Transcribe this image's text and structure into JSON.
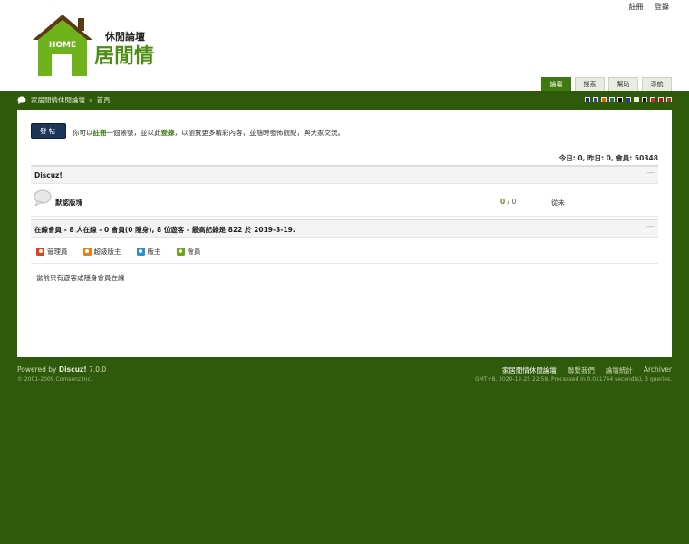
{
  "header": {
    "top_links": [
      "註冊",
      "登錄"
    ],
    "logo": {
      "home_text": "HOME",
      "subtitle": "休閒論壇",
      "title": "居閒情"
    },
    "tabs": [
      {
        "label": "論壇",
        "active": true
      },
      {
        "label": "搜索",
        "active": false
      },
      {
        "label": "幫助",
        "active": false
      },
      {
        "label": "導航",
        "active": false
      }
    ]
  },
  "breadcrumb": {
    "site": "家居閒情休閒論壇",
    "separator": "»",
    "current": "首頁"
  },
  "style_swatches": [
    "#1a2f66",
    "#2a4b8d",
    "#e06010",
    "#2c6a6a",
    "#101010",
    "#1f3f7f",
    "#f0f0c0",
    "#101010",
    "#c03030",
    "#b01818",
    "#a04020"
  ],
  "post_button": "發帖",
  "notice": {
    "prefix": "你可以",
    "register": "註冊",
    "middle": "一個帳號，並以此",
    "login": "登錄",
    "suffix": "，以瀏覽更多精彩內容，並隨時發佈觀點，與大家交流。"
  },
  "stats": "今日: 0, 昨日: 0, 會員: 50348",
  "category": {
    "title": "Discuz!",
    "collapse": "—"
  },
  "forum": {
    "name": "默認版塊",
    "threads": "0",
    "sep": " / ",
    "posts": "0",
    "last_post": "從未"
  },
  "online": {
    "title": "在線會員",
    "summary": " - 8 人在線 - 0 會員(0 隱身), 8 位遊客 - 最高記錄是 822 於 2019-3-19.",
    "collapse": "—",
    "legend": [
      {
        "label": "管理員",
        "color": "#e0401a"
      },
      {
        "label": "超級版主",
        "color": "#e8801a"
      },
      {
        "label": "版主",
        "color": "#2a8ed0"
      },
      {
        "label": "會員",
        "color": "#6aa81a"
      }
    ],
    "note": "當前只有遊客或隱身會員在線"
  },
  "footer": {
    "powered_prefix": "Powered by ",
    "powered_brand": "Discuz!",
    "powered_version": " 7.0.0",
    "copyright": "© 2001-2009 Comsenz Inc.",
    "links": [
      "家居閒情休閒論壇",
      "聯繫我們",
      "論壇統計",
      "Archiver"
    ],
    "info": "GMT+8, 2020-12-25 22:58, Processed in 0.011744 second(s), 3 queries."
  }
}
